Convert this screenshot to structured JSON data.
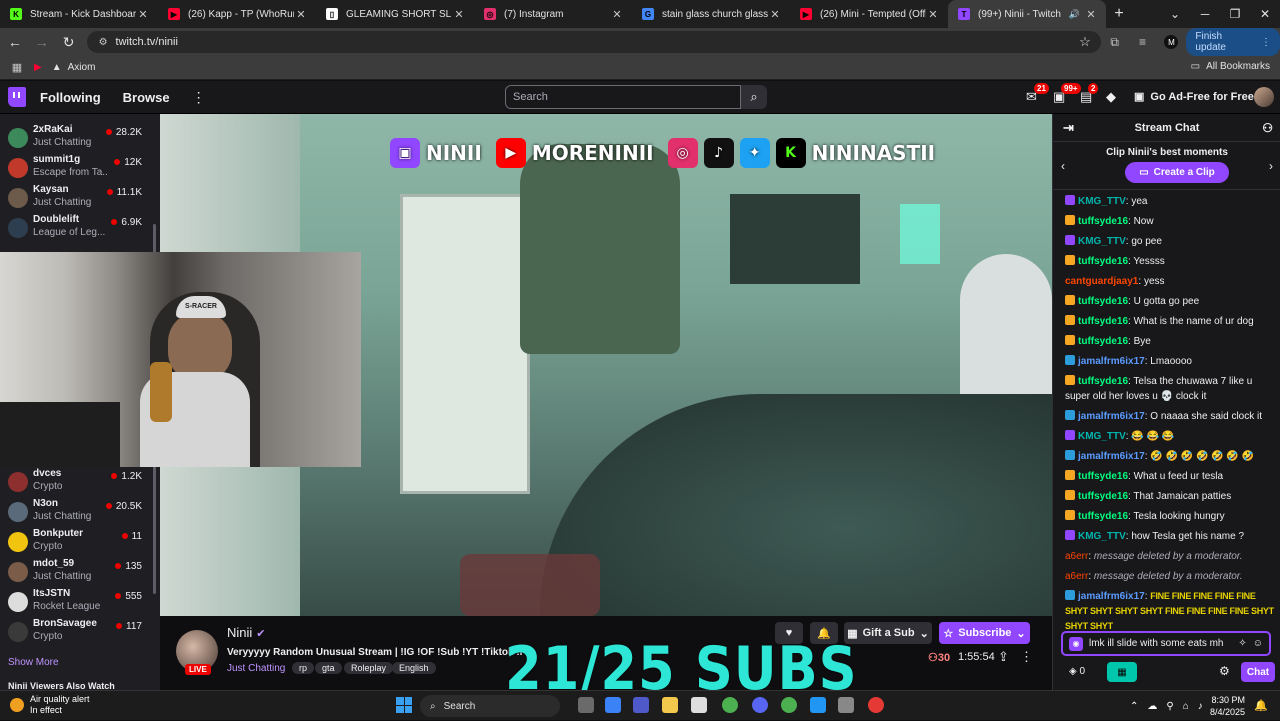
{
  "browser": {
    "tabs": [
      {
        "title": "Stream - Kick Dashboard",
        "fav_color": "#53fc18",
        "fav_glyph": "K"
      },
      {
        "title": "(26) Kapp - TP (WhoRunItNYC",
        "fav_color": "#ff0033",
        "fav_glyph": "▶"
      },
      {
        "title": "GLEAMING SHORT SLEEVE - W",
        "fav_color": "#ffffff",
        "fav_glyph": "▯"
      },
      {
        "title": "(7) Instagram",
        "fav_color": "#e1306c",
        "fav_glyph": "◎"
      },
      {
        "title": "stain glass church glass name",
        "fav_color": "#4285f4",
        "fav_glyph": "G"
      },
      {
        "title": "(26) Mini - Tempted (Official M",
        "fav_color": "#ff0033",
        "fav_glyph": "▶"
      },
      {
        "title": "(99+) Ninii - Twitch",
        "fav_color": "#9146ff",
        "fav_glyph": "T",
        "active": true
      }
    ],
    "url": "twitch.tv/ninii",
    "profile_initial": "M",
    "finish_update": "Finish update",
    "bookmarks": [
      {
        "label": "",
        "color": "#ff0033"
      },
      {
        "label": "Axiom",
        "color": "#e3e3e3"
      }
    ],
    "all_bookmarks": "All Bookmarks"
  },
  "twitch": {
    "nav": {
      "following": "Following",
      "browse": "Browse"
    },
    "search_placeholder": "Search",
    "badges": {
      "inbox": "21",
      "whispers": "99+",
      "notifications": "2"
    },
    "go_adfree": "Go Ad-Free for Free"
  },
  "sidebar": {
    "channels": [
      {
        "name": "2xRaKai",
        "category": "Just Chatting",
        "viewers": "28.2K",
        "color": "#3c8a5c"
      },
      {
        "name": "summit1g",
        "category": "Escape from Ta...",
        "viewers": "12K",
        "color": "#c0392b"
      },
      {
        "name": "Kaysan",
        "category": "Just Chatting",
        "viewers": "11.1K",
        "color": "#6c5a4a"
      },
      {
        "name": "Doublelift",
        "category": "League of Leg...",
        "viewers": "6.9K",
        "color": "#2c3e50"
      },
      {
        "name": "dvces",
        "category": "Crypto",
        "viewers": "1.2K",
        "color": "#8e2f2f"
      },
      {
        "name": "N3on",
        "category": "Just Chatting",
        "viewers": "20.5K",
        "color": "#5a6a7a"
      },
      {
        "name": "Bonkputer",
        "category": "Crypto",
        "viewers": "11",
        "color": "#f1c40f"
      },
      {
        "name": "mdot_59",
        "category": "Just Chatting",
        "viewers": "135",
        "color": "#7a5c48"
      },
      {
        "name": "ItsJSTN",
        "category": "Rocket League",
        "viewers": "555",
        "color": "#dddddd"
      },
      {
        "name": "BronSavagee",
        "category": "Crypto",
        "viewers": "117",
        "color": "#3a3a3a"
      }
    ],
    "show_more": "Show More",
    "viewers_also_watch": "Ninii Viewers Also Watch"
  },
  "video_overlay": {
    "twitch": "NINII",
    "youtube": "MORENINII",
    "kick": "NININASTII",
    "sub_goal": "21/25 SUBS"
  },
  "stream_info": {
    "channel": "Ninii",
    "title": "Veryyyyy Random Unusual Stream | !IG !OF !Sub !YT !Tiktok !i",
    "category": "Just Chatting",
    "tags": [
      "rp",
      "gta",
      "Roleplay",
      "English"
    ],
    "live_label": "LIVE",
    "gift_sub": "Gift a Sub",
    "subscribe": "Subscribe",
    "viewer_count": "30",
    "uptime": "1:55:54"
  },
  "chat": {
    "header": "Stream Chat",
    "clip_title": "Clip Ninii's best moments",
    "create_clip": "Create a Clip",
    "messages": [
      {
        "user": "KMG_TTV",
        "color": "#00b5ad",
        "badge": "#9146ff",
        "text": "yea"
      },
      {
        "user": "tuffsyde16",
        "color": "#00ff7f",
        "badge": "#f5a623",
        "text": "Now"
      },
      {
        "user": "KMG_TTV",
        "color": "#00b5ad",
        "badge": "#9146ff",
        "text": "go pee"
      },
      {
        "user": "tuffsyde16",
        "color": "#00ff7f",
        "badge": "#f5a623",
        "text": "Yessss"
      },
      {
        "user": "cantguardjaay1",
        "color": "#ff4500",
        "badge": "",
        "text": "yess"
      },
      {
        "user": "tuffsyde16",
        "color": "#00ff7f",
        "badge": "#f5a623",
        "text": "U gotta go pee"
      },
      {
        "user": "tuffsyde16",
        "color": "#00ff7f",
        "badge": "#f5a623",
        "text": "What is the name of ur dog"
      },
      {
        "user": "tuffsyde16",
        "color": "#00ff7f",
        "badge": "#f5a623",
        "text": "Bye"
      },
      {
        "user": "jamalfrm6ix17",
        "color": "#5b9bff",
        "badge": "#2d9cdb",
        "text": "Lmaoooo"
      },
      {
        "user": "tuffsyde16",
        "color": "#00ff7f",
        "badge": "#f5a623",
        "text": "Telsa the chuwawa 7 like u super old her loves u 💀 clock it"
      },
      {
        "user": "jamalfrm6ix17",
        "color": "#5b9bff",
        "badge": "#2d9cdb",
        "text": "O naaaa she said clock it"
      },
      {
        "user": "KMG_TTV",
        "color": "#00b5ad",
        "badge": "#9146ff",
        "text": "😂 😂 😂"
      },
      {
        "user": "jamalfrm6ix17",
        "color": "#5b9bff",
        "badge": "#2d9cdb",
        "text": "🤣 🤣 🤣 🤣 🤣 🤣 🤣"
      },
      {
        "user": "tuffsyde16",
        "color": "#00ff7f",
        "badge": "#f5a623",
        "text": "What u feed ur tesla"
      },
      {
        "user": "tuffsyde16",
        "color": "#00ff7f",
        "badge": "#f5a623",
        "text": "That Jamaican patties"
      },
      {
        "user": "tuffsyde16",
        "color": "#00ff7f",
        "badge": "#f5a623",
        "text": "Tesla looking hungry"
      },
      {
        "user": "KMG_TTV",
        "color": "#00b5ad",
        "badge": "#9146ff",
        "text": "how Tesla get his name ?"
      },
      {
        "user": "a6err",
        "color": "#ff4500",
        "badge": "",
        "text": "message deleted by a moderator.",
        "deleted": true
      },
      {
        "user": "a6err",
        "color": "#ff4500",
        "badge": "",
        "text": "message deleted by a moderator.",
        "deleted": true
      },
      {
        "user": "jamalfrm6ix17",
        "color": "#5b9bff",
        "badge": "#2d9cdb",
        "text": "FINE FINE FINE FINE FINE SHYT SHYT SHYT SHYT FINE FINE FINE FINE SHYT SHYT SHYT",
        "emote": true
      }
    ],
    "input_value": "lmk ill slide with some eats mh",
    "points": "0",
    "chat_button": "Chat"
  },
  "taskbar": {
    "weather_title": "Air quality alert",
    "weather_sub": "In effect",
    "search": "Search",
    "time": "8:30 PM",
    "date": "8/4/2025"
  }
}
